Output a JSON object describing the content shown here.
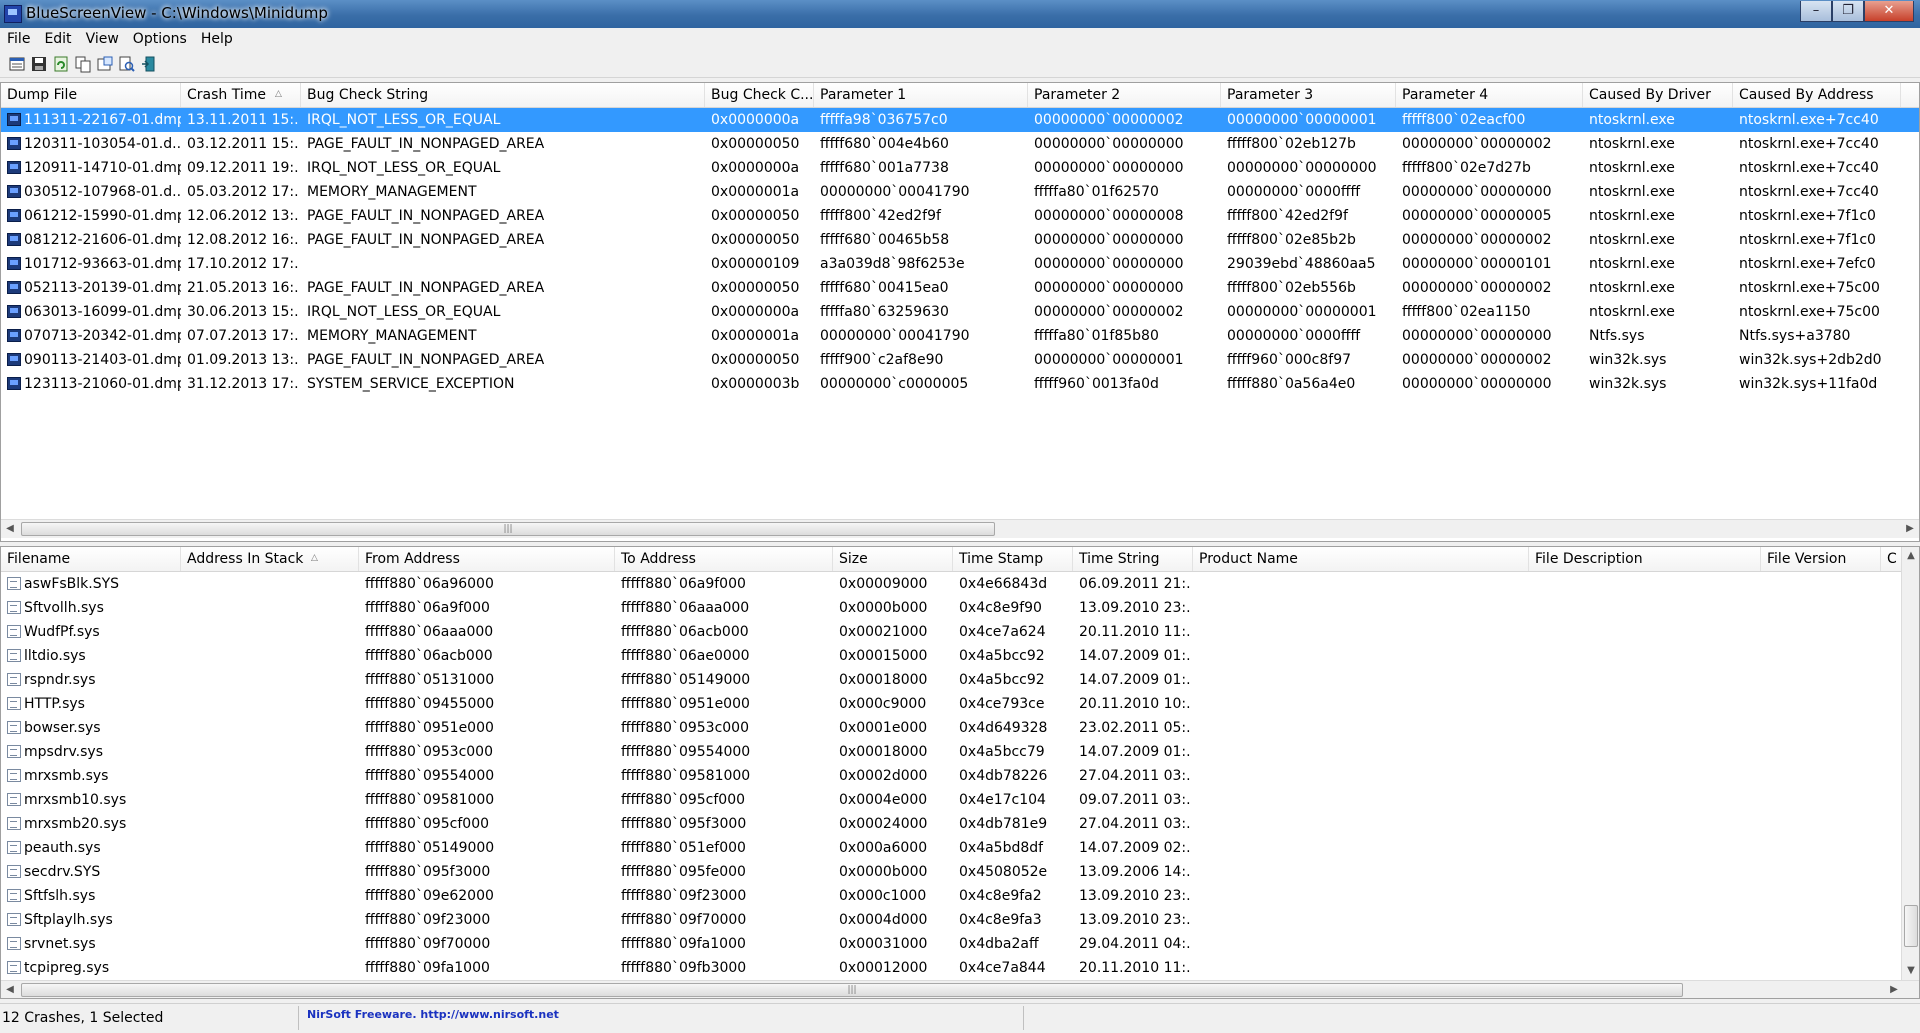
{
  "window": {
    "title": "BlueScreenView   -  C:\\Windows\\Minidump",
    "minimize_glyph": "–",
    "maximize_glyph": "❐",
    "close_glyph": "✕"
  },
  "menu": [
    "File",
    "Edit",
    "View",
    "Options",
    "Help"
  ],
  "toolbar_icons": [
    "html-report-icon",
    "save-icon",
    "refresh-icon",
    "copy-icon",
    "properties-icon",
    "find-icon",
    "exit-icon"
  ],
  "top_table": {
    "columns": [
      "Dump File",
      "Crash Time",
      "Bug Check String",
      "Bug Check C...",
      "Parameter 1",
      "Parameter 2",
      "Parameter 3",
      "Parameter 4",
      "Caused By Driver",
      "Caused By Address"
    ],
    "sort_indicator": "△",
    "rows": [
      [
        "111311-22167-01.dmp",
        "13.11.2011 15:...",
        "IRQL_NOT_LESS_OR_EQUAL",
        "0x0000000a",
        "fffffa98`036757c0",
        "00000000`00000002",
        "00000000`00000001",
        "fffff800`02eacf00",
        "ntoskrnl.exe",
        "ntoskrnl.exe+7cc40"
      ],
      [
        "120311-103054-01.d...",
        "03.12.2011 15:...",
        "PAGE_FAULT_IN_NONPAGED_AREA",
        "0x00000050",
        "fffff680`004e4b60",
        "00000000`00000000",
        "fffff800`02eb127b",
        "00000000`00000002",
        "ntoskrnl.exe",
        "ntoskrnl.exe+7cc40"
      ],
      [
        "120911-14710-01.dmp",
        "09.12.2011 19:...",
        "IRQL_NOT_LESS_OR_EQUAL",
        "0x0000000a",
        "fffff680`001a7738",
        "00000000`00000000",
        "00000000`00000000",
        "fffff800`02e7d27b",
        "ntoskrnl.exe",
        "ntoskrnl.exe+7cc40"
      ],
      [
        "030512-107968-01.d...",
        "05.03.2012 17:...",
        "MEMORY_MANAGEMENT",
        "0x0000001a",
        "00000000`00041790",
        "fffffa80`01f62570",
        "00000000`0000ffff",
        "00000000`00000000",
        "ntoskrnl.exe",
        "ntoskrnl.exe+7cc40"
      ],
      [
        "061212-15990-01.dmp",
        "12.06.2012 13:...",
        "PAGE_FAULT_IN_NONPAGED_AREA",
        "0x00000050",
        "fffff800`42ed2f9f",
        "00000000`00000008",
        "fffff800`42ed2f9f",
        "00000000`00000005",
        "ntoskrnl.exe",
        "ntoskrnl.exe+7f1c0"
      ],
      [
        "081212-21606-01.dmp",
        "12.08.2012 16:...",
        "PAGE_FAULT_IN_NONPAGED_AREA",
        "0x00000050",
        "fffff680`00465b58",
        "00000000`00000000",
        "fffff800`02e85b2b",
        "00000000`00000002",
        "ntoskrnl.exe",
        "ntoskrnl.exe+7f1c0"
      ],
      [
        "101712-93663-01.dmp",
        "17.10.2012 17:...",
        "",
        "0x00000109",
        "a3a039d8`98f6253e",
        "00000000`00000000",
        "29039ebd`48860aa5",
        "00000000`00000101",
        "ntoskrnl.exe",
        "ntoskrnl.exe+7efc0"
      ],
      [
        "052113-20139-01.dmp",
        "21.05.2013 16:...",
        "PAGE_FAULT_IN_NONPAGED_AREA",
        "0x00000050",
        "fffff680`00415ea0",
        "00000000`00000000",
        "fffff800`02eb556b",
        "00000000`00000002",
        "ntoskrnl.exe",
        "ntoskrnl.exe+75c00"
      ],
      [
        "063013-16099-01.dmp",
        "30.06.2013 15:...",
        "IRQL_NOT_LESS_OR_EQUAL",
        "0x0000000a",
        "fffffa80`63259630",
        "00000000`00000002",
        "00000000`00000001",
        "fffff800`02ea1150",
        "ntoskrnl.exe",
        "ntoskrnl.exe+75c00"
      ],
      [
        "070713-20342-01.dmp",
        "07.07.2013 17:...",
        "MEMORY_MANAGEMENT",
        "0x0000001a",
        "00000000`00041790",
        "fffffa80`01f85b80",
        "00000000`0000ffff",
        "00000000`00000000",
        "Ntfs.sys",
        "Ntfs.sys+a3780"
      ],
      [
        "090113-21403-01.dmp",
        "01.09.2013 13:...",
        "PAGE_FAULT_IN_NONPAGED_AREA",
        "0x00000050",
        "fffff900`c2af8e90",
        "00000000`00000001",
        "fffff960`000c8f97",
        "00000000`00000002",
        "win32k.sys",
        "win32k.sys+2db2d0"
      ],
      [
        "123113-21060-01.dmp",
        "31.12.2013 17:...",
        "SYSTEM_SERVICE_EXCEPTION",
        "0x0000003b",
        "00000000`c0000005",
        "fffff960`0013fa0d",
        "fffff880`0a56a4e0",
        "00000000`00000000",
        "win32k.sys",
        "win32k.sys+11fa0d"
      ]
    ],
    "selected_index": 0
  },
  "bottom_table": {
    "columns": [
      "Filename",
      "Address In Stack",
      "From Address",
      "To Address",
      "Size",
      "Time Stamp",
      "Time String",
      "Product Name",
      "File Description",
      "File Version",
      "C"
    ],
    "sort_indicator": "△",
    "rows": [
      [
        "aswFsBlk.SYS",
        "",
        "fffff880`06a96000",
        "fffff880`06a9f000",
        "0x00009000",
        "0x4e66843d",
        "06.09.2011 21:..."
      ],
      [
        "Sftvollh.sys",
        "",
        "fffff880`06a9f000",
        "fffff880`06aaa000",
        "0x0000b000",
        "0x4c8e9f90",
        "13.09.2010 23:..."
      ],
      [
        "WudfPf.sys",
        "",
        "fffff880`06aaa000",
        "fffff880`06acb000",
        "0x00021000",
        "0x4ce7a624",
        "20.11.2010 11:..."
      ],
      [
        "lltdio.sys",
        "",
        "fffff880`06acb000",
        "fffff880`06ae0000",
        "0x00015000",
        "0x4a5bcc92",
        "14.07.2009 01:..."
      ],
      [
        "rspndr.sys",
        "",
        "fffff880`05131000",
        "fffff880`05149000",
        "0x00018000",
        "0x4a5bcc92",
        "14.07.2009 01:..."
      ],
      [
        "HTTP.sys",
        "",
        "fffff880`09455000",
        "fffff880`0951e000",
        "0x000c9000",
        "0x4ce793ce",
        "20.11.2010 10:..."
      ],
      [
        "bowser.sys",
        "",
        "fffff880`0951e000",
        "fffff880`0953c000",
        "0x0001e000",
        "0x4d649328",
        "23.02.2011 05:..."
      ],
      [
        "mpsdrv.sys",
        "",
        "fffff880`0953c000",
        "fffff880`09554000",
        "0x00018000",
        "0x4a5bcc79",
        "14.07.2009 01:..."
      ],
      [
        "mrxsmb.sys",
        "",
        "fffff880`09554000",
        "fffff880`09581000",
        "0x0002d000",
        "0x4db78226",
        "27.04.2011 03:..."
      ],
      [
        "mrxsmb10.sys",
        "",
        "fffff880`09581000",
        "fffff880`095cf000",
        "0x0004e000",
        "0x4e17c104",
        "09.07.2011 03:..."
      ],
      [
        "mrxsmb20.sys",
        "",
        "fffff880`095cf000",
        "fffff880`095f3000",
        "0x00024000",
        "0x4db781e9",
        "27.04.2011 03:..."
      ],
      [
        "peauth.sys",
        "",
        "fffff880`05149000",
        "fffff880`051ef000",
        "0x000a6000",
        "0x4a5bd8df",
        "14.07.2009 02:..."
      ],
      [
        "secdrv.SYS",
        "",
        "fffff880`095f3000",
        "fffff880`095fe000",
        "0x0000b000",
        "0x4508052e",
        "13.09.2006 14:..."
      ],
      [
        "Sftfslh.sys",
        "",
        "fffff880`09e62000",
        "fffff880`09f23000",
        "0x000c1000",
        "0x4c8e9fa2",
        "13.09.2010 23:..."
      ],
      [
        "Sftplaylh.sys",
        "",
        "fffff880`09f23000",
        "fffff880`09f70000",
        "0x0004d000",
        "0x4c8e9fa3",
        "13.09.2010 23:..."
      ],
      [
        "srvnet.sys",
        "",
        "fffff880`09f70000",
        "fffff880`09fa1000",
        "0x00031000",
        "0x4dba2aff",
        "29.04.2011 04:..."
      ],
      [
        "tcpipreg.sys",
        "",
        "fffff880`09fa1000",
        "fffff880`09fb3000",
        "0x00012000",
        "0x4ce7a844",
        "20.11.2010 11:..."
      ]
    ]
  },
  "scroll_grip": "|||",
  "status": {
    "count": "12 Crashes, 1 Selected",
    "credit": "NirSoft Freeware.  http://www.nirsoft.net"
  },
  "colors": {
    "selection": "#3399ff",
    "credit_link": "#1a32c0"
  }
}
